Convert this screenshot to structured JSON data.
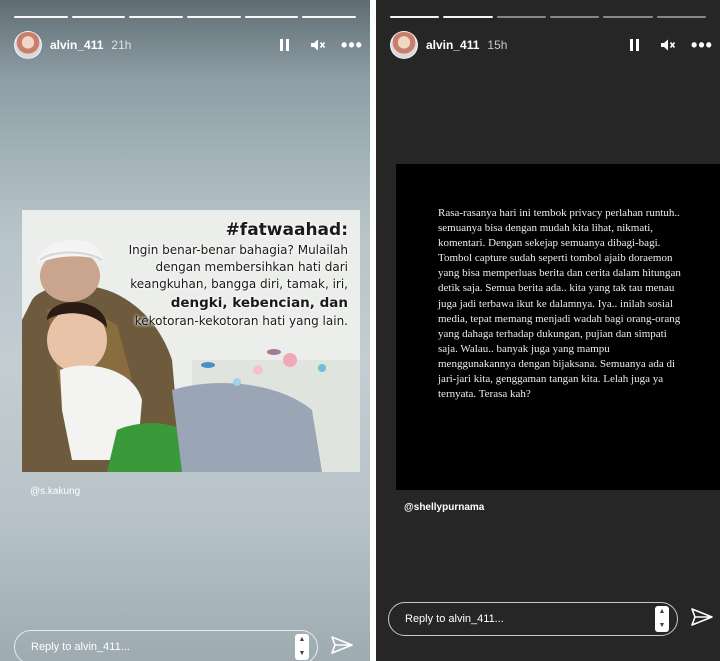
{
  "left_story": {
    "username": "alvin_411",
    "time": "21h",
    "progress": {
      "segments": 6,
      "done": 6
    },
    "quote": {
      "hashtag": "#fatwaahad:",
      "lines": [
        "Ingin benar-benar bahagia? Mulailah",
        "dengan membersihkan hati dari",
        "keangkuhan, bangga diri, tamak, iri,",
        "dengki, kebencian, dan",
        "kekotoran-kekotoran hati yang lain."
      ]
    },
    "credit": "@s.kakung",
    "reply_placeholder": "Reply to alvin_411..."
  },
  "right_story": {
    "username": "alvin_411",
    "time": "15h",
    "progress": {
      "segments": 6,
      "done": 2
    },
    "body": "Rasa-rasanya hari ini tembok privacy perlahan runtuh.. semuanya bisa dengan mudah kita lihat, nikmati, komentari. Dengan sekejap semuanya dibagi-bagi. Tombol capture sudah seperti tombol ajaib doraemon yang bisa memperluas berita dan cerita dalam hitungan detik saja. Semua berita ada.. kita yang tak tau menau juga jadi terbawa ikut ke dalamnya. Iya.. inilah sosial media, tepat memang menjadi wadah  bagi orang-orang yang dahaga terhadap dukungan, pujian dan simpati saja. Walau.. banyak juga yang mampu menggunakannya dengan bijaksana. Semuanya ada di jari-jari kita, genggaman tangan kita. Lelah juga ya ternyata. Terasa kah?",
    "credit": "@shellypurnama",
    "reply_placeholder": "Reply to alvin_411..."
  },
  "icons": {
    "pause": "pause-icon",
    "mute": "speaker-mute-icon",
    "more": "more-icon",
    "send": "send-icon"
  },
  "colors": {
    "right_bg": "#262626",
    "card_black": "#000000"
  }
}
